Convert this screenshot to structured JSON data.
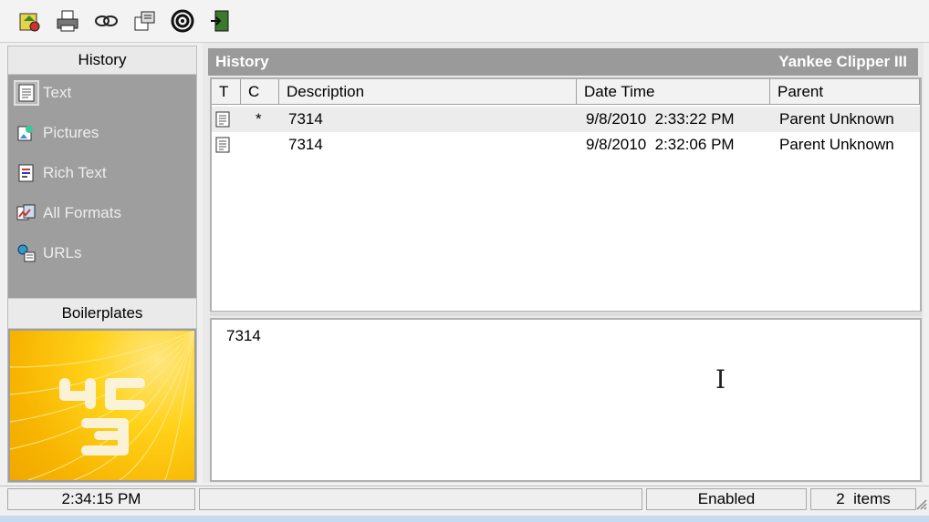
{
  "toolbar": {
    "icons": [
      "options-icon",
      "print-icon",
      "clipboard-link-icon",
      "properties-icon",
      "target-icon",
      "exit-icon"
    ]
  },
  "sidebar": {
    "header": "History",
    "items": [
      {
        "label": "Text",
        "icon": "text-doc-icon",
        "selected": true
      },
      {
        "label": "Pictures",
        "icon": "pictures-icon",
        "selected": false
      },
      {
        "label": "Rich Text",
        "icon": "rich-text-icon",
        "selected": false
      },
      {
        "label": "All Formats",
        "icon": "all-formats-icon",
        "selected": false
      },
      {
        "label": "URLs",
        "icon": "urls-icon",
        "selected": false
      }
    ],
    "boilerplates_label": "Boilerplates",
    "logo_text": "yc 3"
  },
  "main": {
    "title": "History",
    "app_name": "Yankee Clipper III",
    "columns": [
      "T",
      "C",
      "Description",
      "Date Time",
      "Parent"
    ],
    "rows": [
      {
        "t_icon": "text-doc-icon",
        "c": "*",
        "description": "7314",
        "datetime": "9/8/2010  2:33:22 PM",
        "parent": "Parent Unknown"
      },
      {
        "t_icon": "text-doc-icon",
        "c": "",
        "description": "7314",
        "datetime": "9/8/2010  2:32:06 PM",
        "parent": "Parent Unknown"
      }
    ],
    "detail_text": "7314"
  },
  "status": {
    "time": "2:34:15 PM",
    "blank": "",
    "state": "Enabled",
    "items": "2  items"
  },
  "colors": {
    "sidebar_bg": "#9e9e9e",
    "title_bar_bg": "#9a9a9a",
    "logo_yellow": "#ffd21a"
  }
}
